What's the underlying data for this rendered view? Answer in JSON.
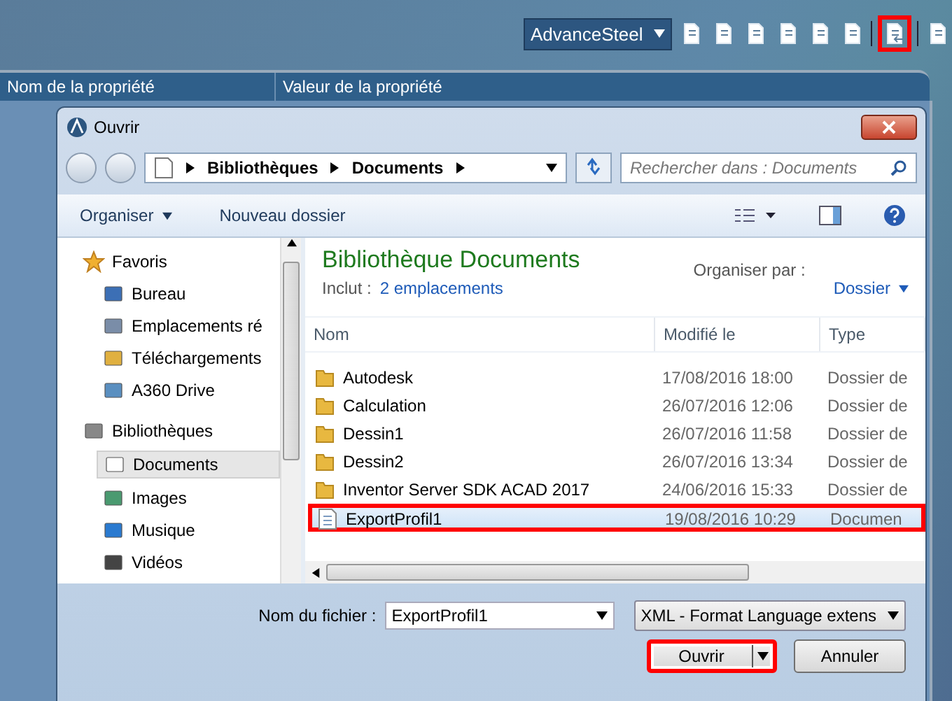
{
  "toolbar": {
    "workspace": "AdvanceSteel",
    "tools": [
      {
        "highlighted": false
      },
      {
        "highlighted": false
      },
      {
        "highlighted": false
      },
      {
        "highlighted": false
      },
      {
        "highlighted": false
      },
      {
        "highlighted": false
      },
      {
        "highlighted": true
      },
      {
        "highlighted": false
      }
    ]
  },
  "property_header": {
    "columns": [
      "Nom de la propriété",
      "Valeur de la propriété"
    ]
  },
  "dialog": {
    "title": "Ouvrir",
    "path": [
      "Bibliothèques",
      "Documents"
    ],
    "search": {
      "placeholder": "Rechercher dans : Documents"
    },
    "commands": [
      "Organiser",
      "Nouveau dossier"
    ],
    "nav": [
      {
        "label": "Favoris",
        "selected": false,
        "children": [
          {
            "label": "Bureau",
            "selected": false
          },
          {
            "label": "Emplacements ré",
            "selected": false
          },
          {
            "label": "Téléchargements",
            "selected": false
          },
          {
            "label": "A360 Drive",
            "selected": false
          }
        ]
      },
      {
        "label": "Bibliothèques",
        "selected": false,
        "children": [
          {
            "label": "Documents",
            "selected": true
          },
          {
            "label": "Images",
            "selected": false
          },
          {
            "label": "Musique",
            "selected": false
          },
          {
            "label": "Vidéos",
            "selected": false
          }
        ]
      }
    ],
    "library": {
      "title": "Bibliothèque Documents",
      "includes_label": "Inclut :",
      "includes_link": "2 emplacements",
      "arrange_label": "Organiser par :",
      "arrange_value": "Dossier"
    },
    "columns": [
      "Nom",
      "Modifié le",
      "Type"
    ],
    "files": [
      {
        "kind": "folder",
        "name": "Autodesk",
        "modified": "17/08/2016 18:00",
        "type": "Dossier de",
        "selected": false,
        "highlighted": false
      },
      {
        "kind": "folder",
        "name": "Calculation",
        "modified": "26/07/2016 12:06",
        "type": "Dossier de",
        "selected": false,
        "highlighted": false
      },
      {
        "kind": "folder",
        "name": "Dessin1",
        "modified": "26/07/2016 11:58",
        "type": "Dossier de",
        "selected": false,
        "highlighted": false
      },
      {
        "kind": "folder",
        "name": "Dessin2",
        "modified": "26/07/2016 13:34",
        "type": "Dossier de",
        "selected": false,
        "highlighted": false
      },
      {
        "kind": "folder",
        "name": "Inventor Server SDK ACAD 2017",
        "modified": "24/06/2016 15:33",
        "type": "Dossier de",
        "selected": false,
        "highlighted": false
      },
      {
        "kind": "file",
        "name": "ExportProfil1",
        "modified": "19/08/2016 10:29",
        "type": "Documen",
        "selected": true,
        "highlighted": true
      }
    ],
    "filename_label": "Nom du fichier :",
    "filename": "ExportProfil1",
    "filetype": "XML - Format Language extens",
    "buttons": [
      {
        "label": "Ouvrir",
        "kind": "split",
        "highlighted": true
      },
      {
        "label": "Annuler",
        "kind": "plain",
        "highlighted": false
      }
    ]
  }
}
